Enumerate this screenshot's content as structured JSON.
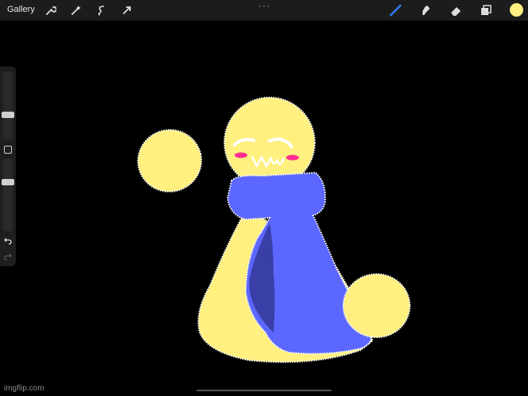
{
  "topbar": {
    "gallery_label": "Gallery",
    "left_tools": [
      "wrench-icon",
      "magic-wand-icon",
      "selection-icon",
      "transform-arrow-icon"
    ],
    "more_label": "···",
    "right_tools": [
      "brush-icon",
      "smudge-icon",
      "eraser-icon",
      "layers-icon"
    ],
    "active_color": "#fff080",
    "brush_color": "#2f7bff"
  },
  "sidebar": {
    "brush_size": 0.3,
    "opacity": 0.72,
    "undo_icon": "undo-icon",
    "redo_icon": "redo-icon"
  },
  "artwork": {
    "body_color": "#fff080",
    "scarf_color": "#5b67ff",
    "scarf_shadow": "#3a3fa8",
    "blush_color": "#ff2f8f"
  },
  "watermark": "imgflip.com"
}
